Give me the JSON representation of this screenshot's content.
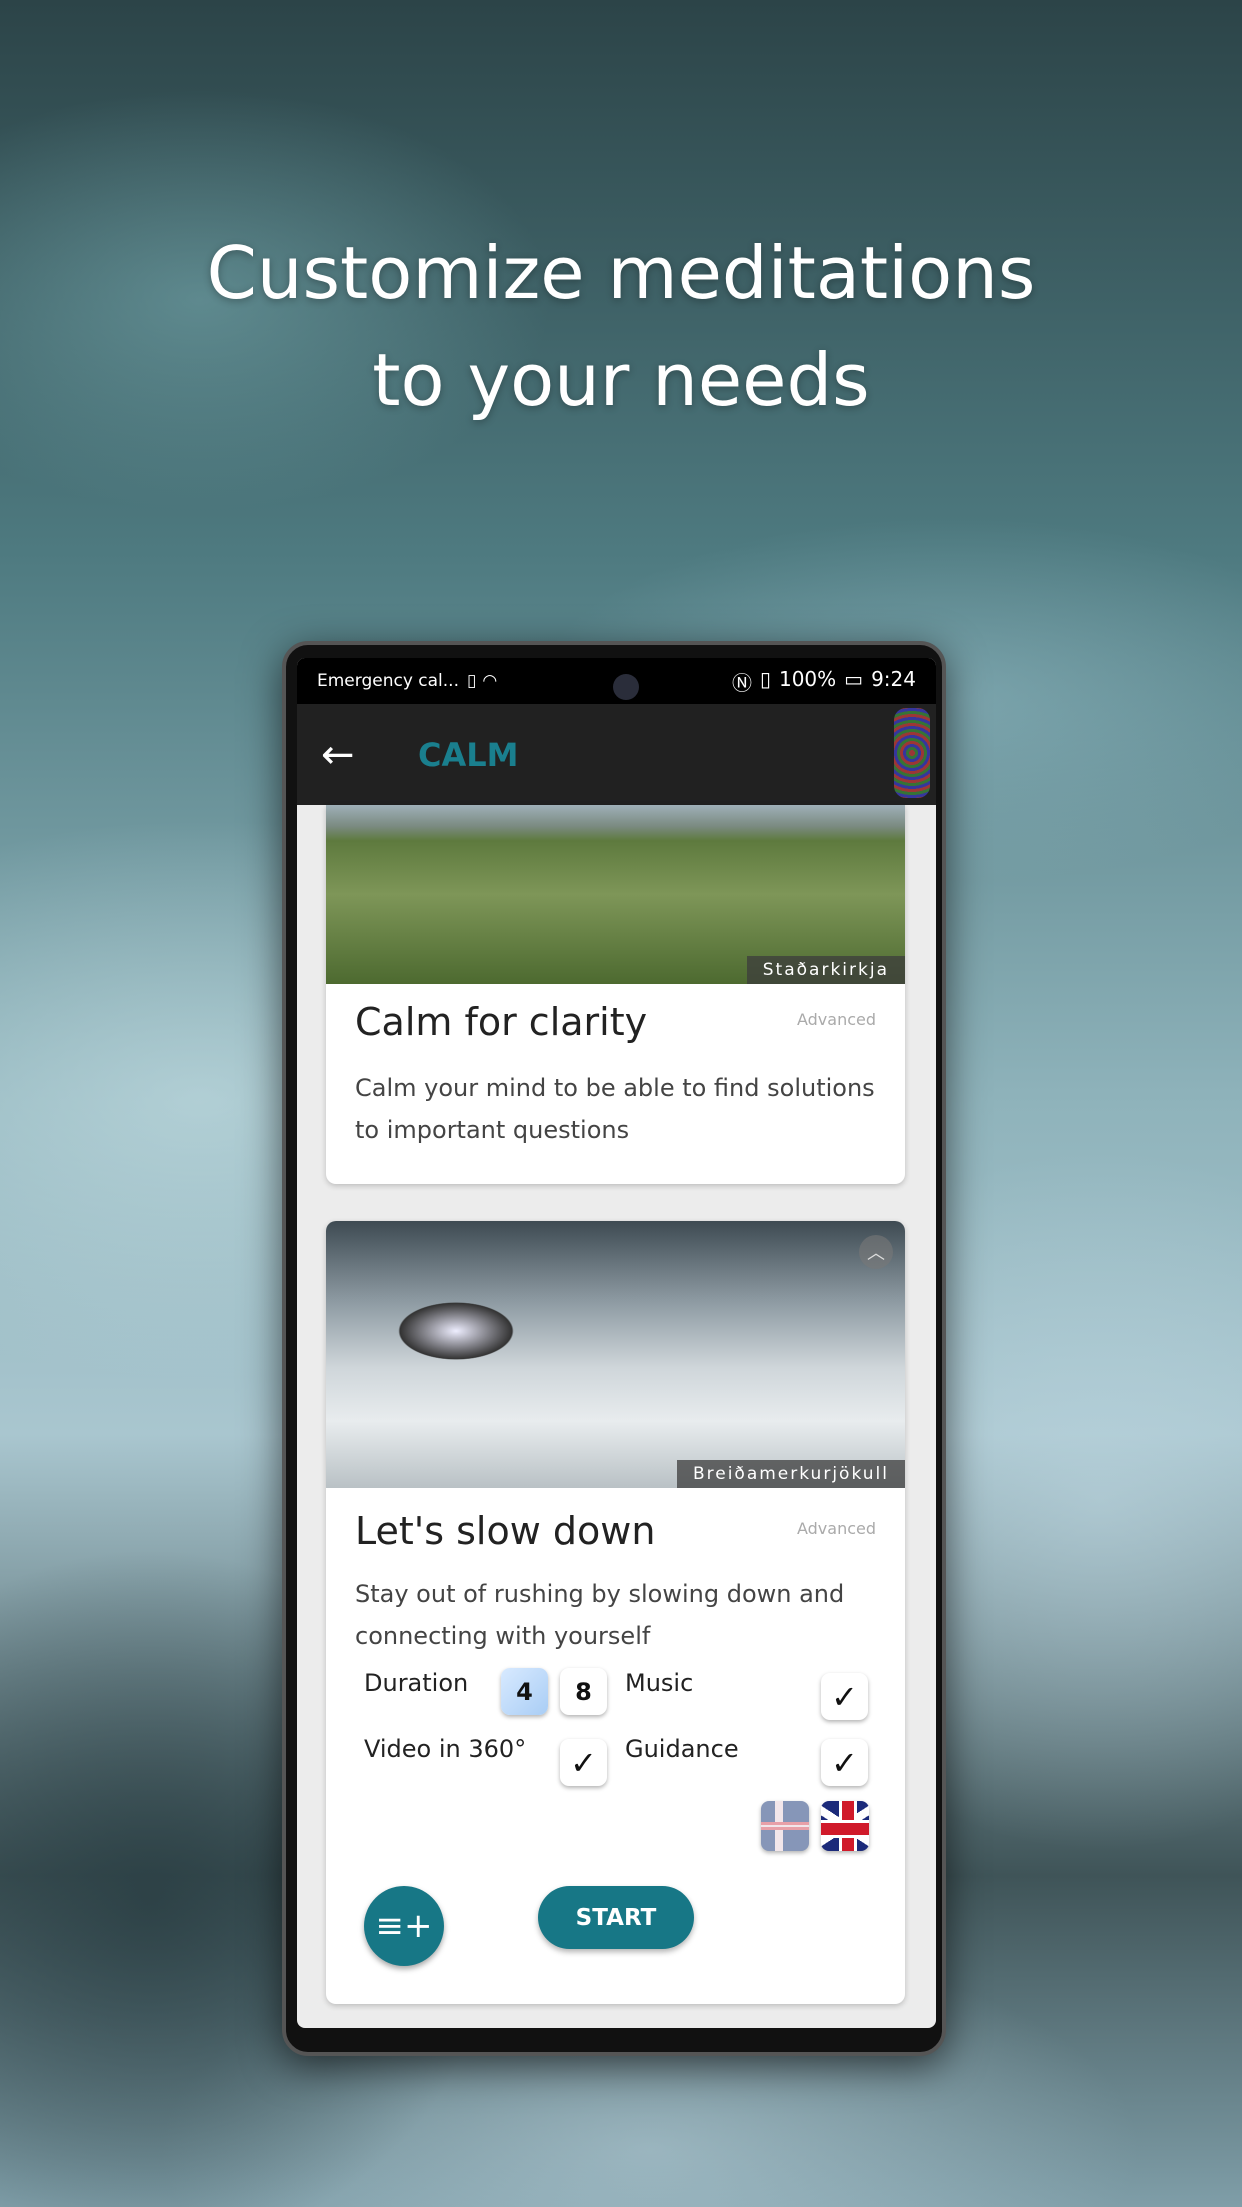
{
  "headline": {
    "line1": "Customize meditations",
    "line2": "to your needs"
  },
  "status_bar": {
    "left": "Emergency cal...",
    "battery": "100%",
    "time": "9:24",
    "icons": [
      "sim-alert-icon",
      "wifi-icon",
      "nfc-icon",
      "vibrate-icon",
      "battery-charging-icon"
    ]
  },
  "app_bar": {
    "title": "CALM",
    "title_color": "#1a7f8e"
  },
  "cards": [
    {
      "location": "Staðarkirkja",
      "title": "Calm for clarity",
      "level": "Advanced",
      "description": "Calm your mind to be able to find solutions to important questions"
    },
    {
      "location": "Breiðamerkurjökull",
      "title": "Let's slow down",
      "level": "Advanced",
      "description": "Stay out of rushing by slowing down and connecting with yourself",
      "options": {
        "duration_label": "Duration",
        "durations": [
          "4",
          "8"
        ],
        "selected_duration": "4",
        "music_label": "Music",
        "music": true,
        "video_label": "Video in 360°",
        "video": true,
        "guidance_label": "Guidance",
        "guidance": true,
        "languages": [
          "Icelandic",
          "English"
        ]
      },
      "start_label": "START"
    }
  ],
  "accent": "#177786"
}
